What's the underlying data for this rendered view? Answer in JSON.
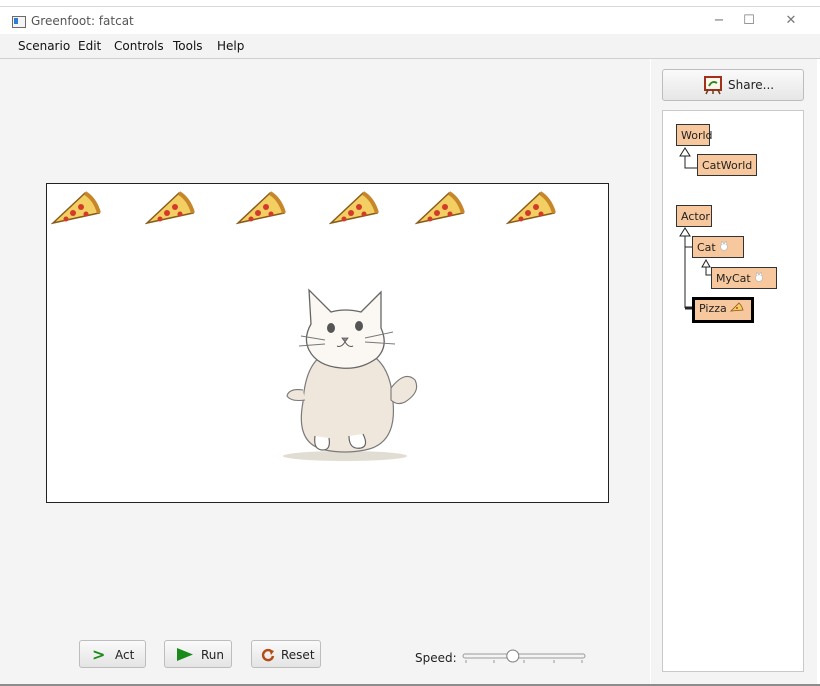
{
  "window": {
    "title": "Greenfoot: fatcat",
    "minimize": "−",
    "maximize": "☐",
    "close": "✕"
  },
  "menu": {
    "items": [
      "Scenario",
      "Edit",
      "Controls",
      "Tools",
      "Help"
    ]
  },
  "share": {
    "label": "Share..."
  },
  "classes": {
    "world_root": "World",
    "world_sub": "CatWorld",
    "actor_root": "Actor",
    "cat": "Cat",
    "mycat": "MyCat",
    "pizza": "Pizza"
  },
  "controls": {
    "act": "Act",
    "run": "Run",
    "reset": "Reset",
    "speed_label": "Speed:",
    "speed_value": 0.4
  },
  "colors": {
    "class_box": "#f7c89d",
    "act_arrow": "#1a8a1a",
    "run_arrow": "#1a8a1a",
    "reset_icon": "#b54a14"
  }
}
